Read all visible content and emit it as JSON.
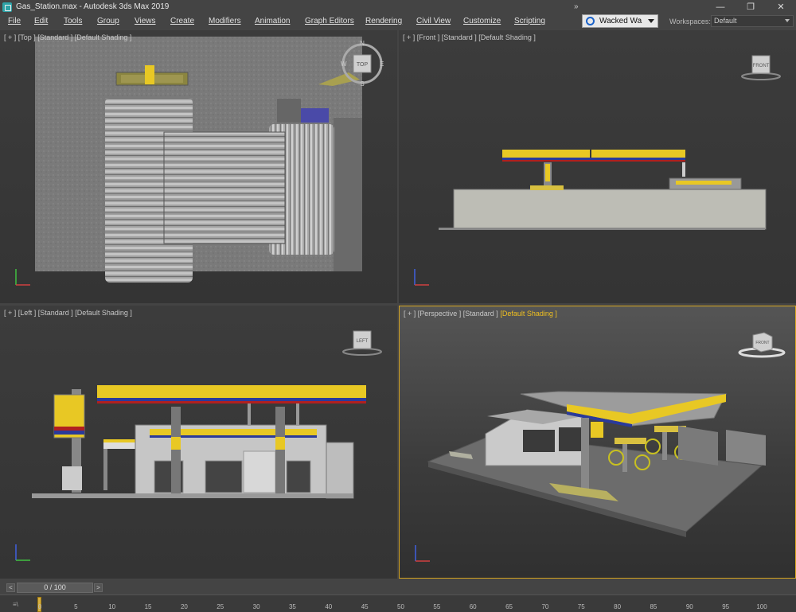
{
  "window": {
    "title": "Gas_Station.max - Autodesk 3ds Max 2019",
    "controls": [
      "—",
      "❐",
      "✕"
    ]
  },
  "menu": [
    "File",
    "Edit",
    "Tools",
    "Group",
    "Views",
    "Create",
    "Modifiers",
    "Animation",
    "Graph Editors",
    "Rendering",
    "Civil View",
    "Customize",
    "Scripting"
  ],
  "menu_overflow": "»",
  "user": {
    "name": "Wacked Wa",
    "icon": "user-icon"
  },
  "workspaces": {
    "label": "Workspaces:",
    "value": "Default"
  },
  "viewports": {
    "top": {
      "label": "[ + ] [Top ] [Standard ] [Default Shading ]",
      "viewcube": "TOP",
      "compass": {
        "n": "N",
        "s": "S",
        "w": "W",
        "e": "E"
      }
    },
    "front": {
      "label": "[ + ] [Front ] [Standard ] [Default Shading ]",
      "viewcube": "FRONT"
    },
    "left": {
      "label": "[ + ] [Left ] [Standard ] [Default Shading ]",
      "viewcube": "LEFT"
    },
    "perspective": {
      "label_prefix": "[ + ] [Perspective ] [Standard ] ",
      "label_active": "[Default Shading ]",
      "viewcube": "FRONT"
    }
  },
  "timeline": {
    "frame_display": "0 / 100",
    "prev_icon": "chevron-left-icon",
    "next_icon": "chevron-right-icon",
    "left_label": "≡\\",
    "ticks": [
      "0",
      "5",
      "10",
      "15",
      "20",
      "25",
      "30",
      "35",
      "40",
      "45",
      "50",
      "55",
      "60",
      "65",
      "70",
      "75",
      "80",
      "85",
      "90",
      "95",
      "100"
    ]
  },
  "colors": {
    "accent_yellow": "#e8c824",
    "accent_blue": "#2a3a9a",
    "accent_red": "#b02020",
    "active_viewport_border": "#d6a520"
  }
}
